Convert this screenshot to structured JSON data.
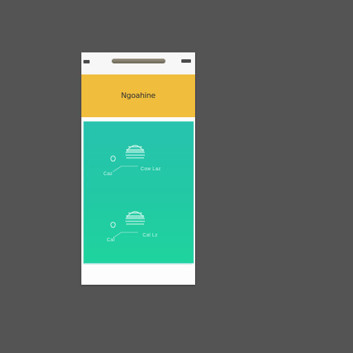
{
  "app": {
    "header_title": "Ngoahine"
  },
  "cards": [
    {
      "left_label": "Caz",
      "right_label": "Cow Laz",
      "icon": "tent-icon",
      "pin_icon": "pin-icon"
    },
    {
      "left_label": "Cal",
      "right_label": "Cal Lz",
      "icon": "tent-icon",
      "pin_icon": "pin-icon"
    }
  ],
  "colors": {
    "background": "#555455",
    "header": "#f0bd3c",
    "content_top": "#27c3ae",
    "content_bottom": "#1fd49d",
    "device": "#fdfdfd"
  }
}
